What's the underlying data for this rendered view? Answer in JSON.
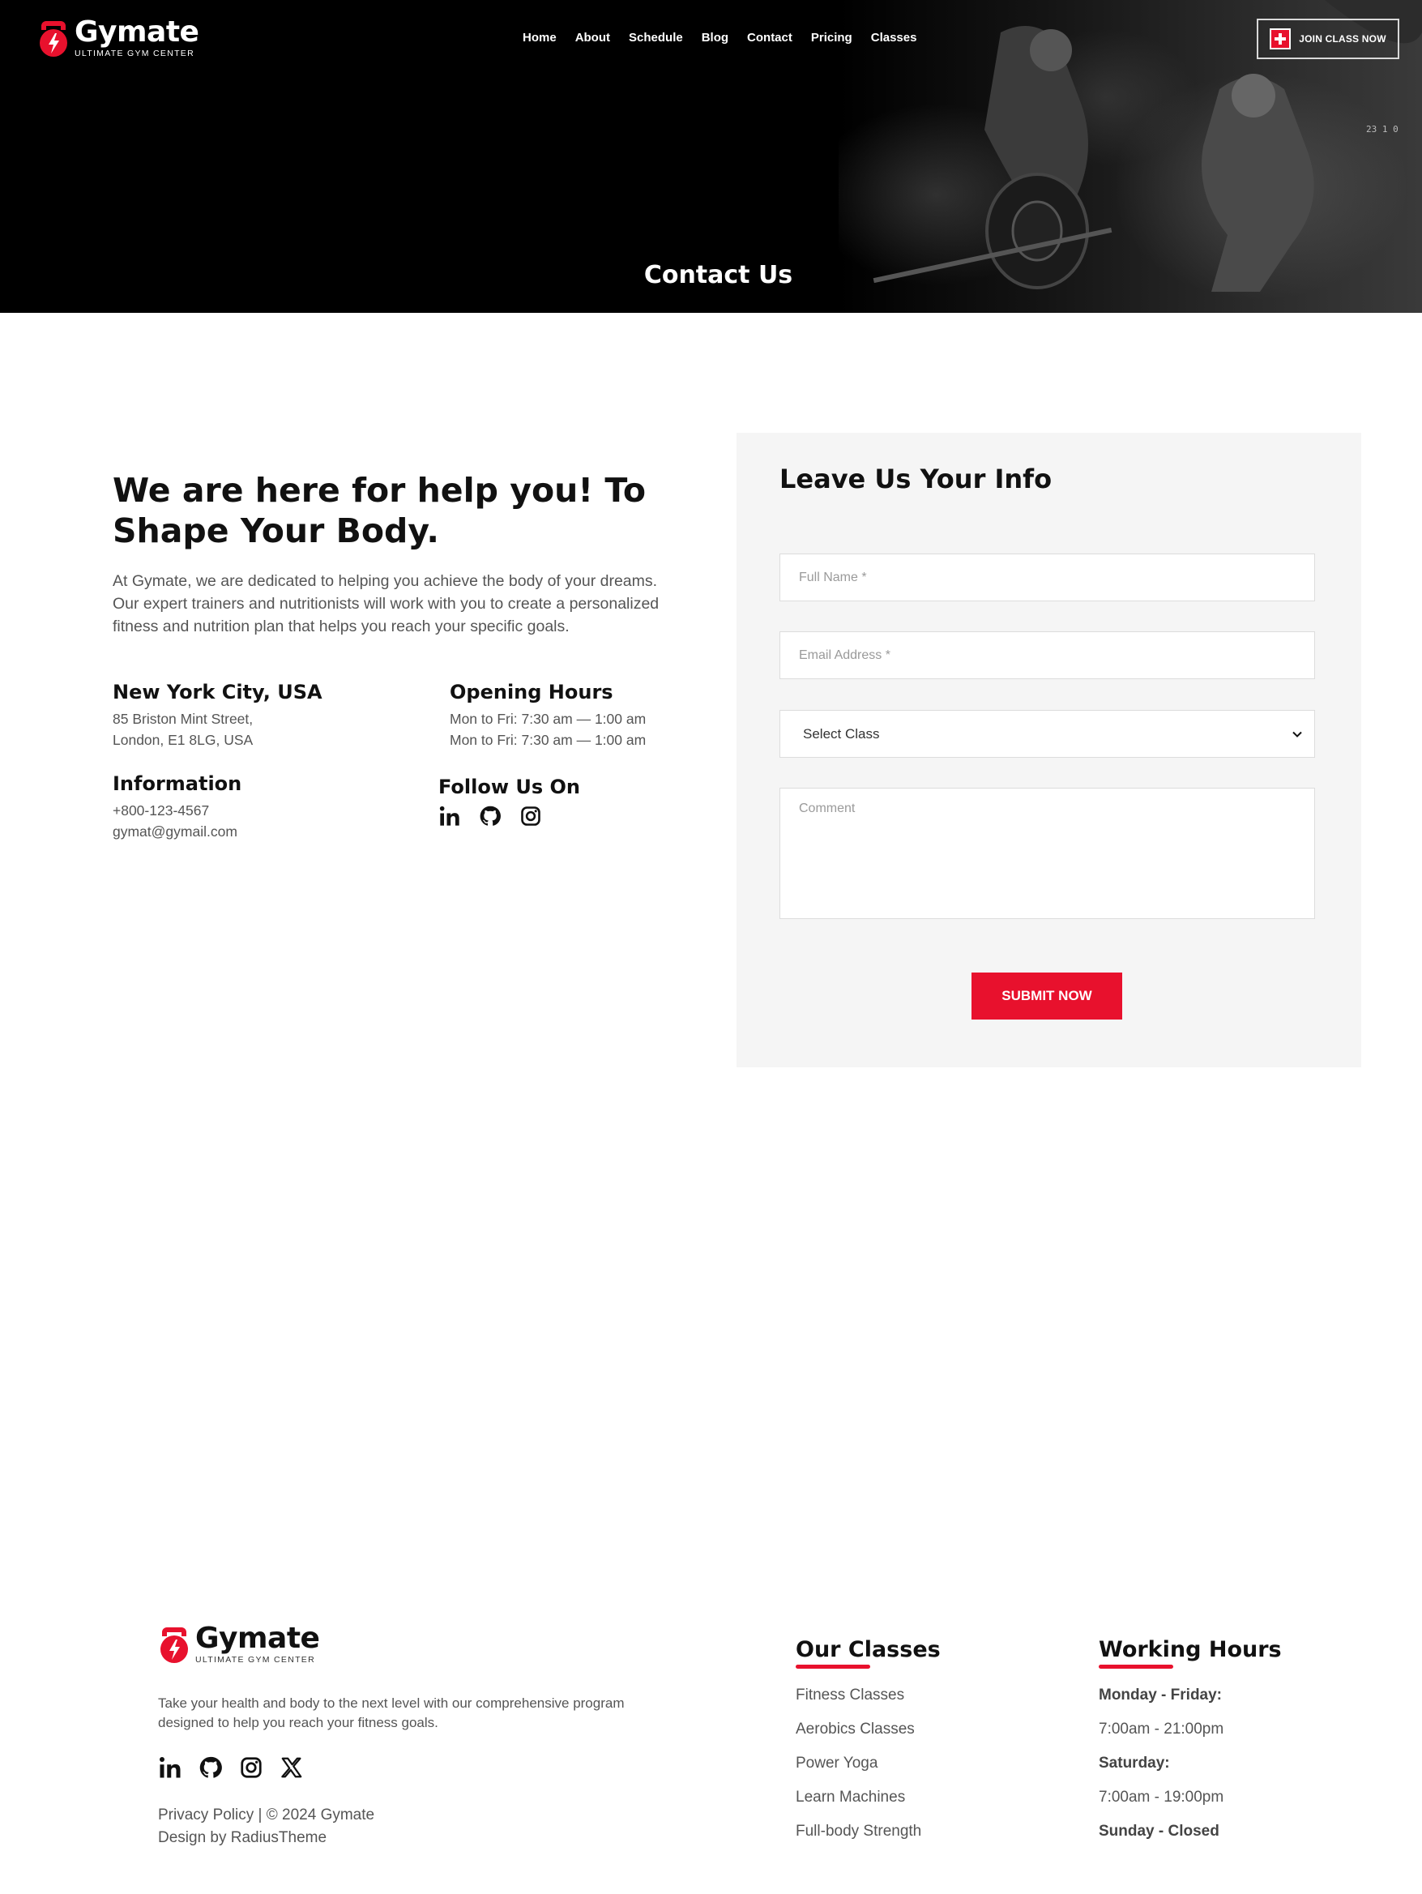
{
  "header": {
    "logo_name": "Gymate",
    "logo_tagline": "ULTIMATE GYM CENTER",
    "nav": [
      "Home",
      "About",
      "Schedule",
      "Blog",
      "Contact",
      "Pricing",
      "Classes"
    ],
    "join_label": "JOIN CLASS NOW",
    "slide_counter": "23 1 0"
  },
  "hero": {
    "title": "Contact Us"
  },
  "intro": {
    "heading": "We are here for help you! To Shape Your Body.",
    "text": "At Gymate, we are dedicated to helping you achieve the body of your dreams. Our expert trainers and nutritionists will work with you to create a personalized fitness and nutrition plan that helps you reach your specific goals."
  },
  "location": {
    "title": "New York City, USA",
    "line1": "85 Briston Mint Street,",
    "line2": "London, E1 8LG, USA"
  },
  "hours": {
    "title": "Opening Hours",
    "line1": "Mon to Fri: 7:30 am — 1:00 am",
    "line2": "Mon to Fri: 7:30 am — 1:00 am"
  },
  "information": {
    "title": "Information",
    "phone": "+800-123-4567",
    "email": "gymat@gymail.com"
  },
  "follow": {
    "title": "Follow Us On",
    "icons": [
      "linkedin-icon",
      "github-icon",
      "instagram-icon"
    ]
  },
  "form": {
    "title": "Leave Us Your Info",
    "full_name_placeholder": "Full Name *",
    "email_placeholder": "Email Address *",
    "select_value": "Select Class",
    "comment_placeholder": "Comment",
    "submit_label": "SUBMIT NOW"
  },
  "footer": {
    "text": "Take your health and body to the next level with our comprehensive program designed to help you reach your fitness goals.",
    "icons": [
      "linkedin-icon",
      "github-icon",
      "instagram-icon",
      "x-icon"
    ],
    "copy_line1": "Privacy Policy | © 2024 Gymate",
    "copy_line2": "Design by RadiusTheme",
    "classes_title": "Our Classes",
    "classes": [
      "Fitness Classes",
      "Aerobics Classes",
      "Power Yoga",
      "Learn Machines",
      "Full-body Strength"
    ],
    "hours_title": "Working Hours",
    "hours": [
      "Monday - Friday:",
      "7:00am - 21:00pm",
      "Saturday:",
      "7:00am - 19:00pm",
      "Sunday - Closed"
    ]
  },
  "colors": {
    "accent": "#e8112d",
    "hero_bg": "#000000",
    "panel_bg": "#f5f5f5"
  }
}
